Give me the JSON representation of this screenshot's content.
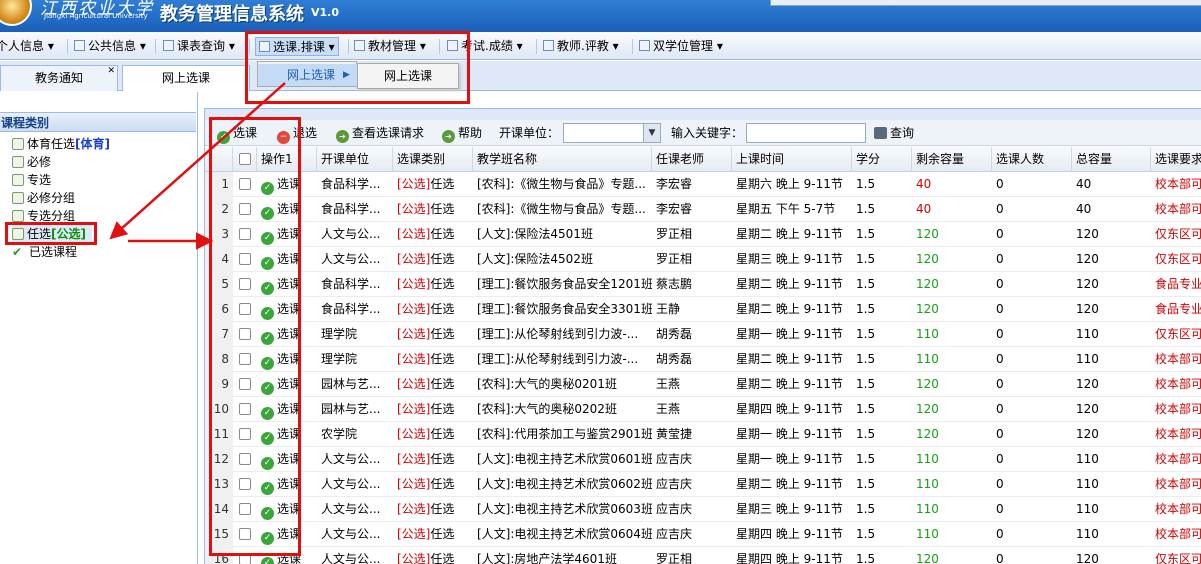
{
  "header": {
    "school_name_cn": "江西农业大学",
    "school_name_en": "Jiangxi Agricultural University",
    "system_title": "教务管理信息系统",
    "version": "V1.0"
  },
  "menubar": {
    "items": [
      {
        "label": "个人信息"
      },
      {
        "label": "公共信息"
      },
      {
        "label": "课表查询"
      },
      {
        "label": "选课.排课"
      },
      {
        "label": "教材管理"
      },
      {
        "label": "考试.成绩"
      },
      {
        "label": "教师.评教"
      },
      {
        "label": "双学位管理"
      }
    ],
    "dropdown_item": "网上选课",
    "submenu_item": "网上选课"
  },
  "tabs": [
    {
      "label": "教务通知"
    },
    {
      "label": "网上选课"
    }
  ],
  "left_panel": {
    "title": "课程类别",
    "items": [
      {
        "label": "体育任选",
        "suffix": "[体育]"
      },
      {
        "label": "必修"
      },
      {
        "label": "专选"
      },
      {
        "label": "必修分组"
      },
      {
        "label": "专选分组"
      },
      {
        "label": "任选",
        "suffix": "[公选]"
      },
      {
        "label": "已选课程"
      }
    ]
  },
  "toolbar": {
    "select_label": "选课",
    "drop_label": "退选",
    "view_requests_label": "查看选课请求",
    "help_label": "帮助",
    "unit_label": "开课单位：",
    "unit_value": "",
    "keyword_label": "输入关键字：",
    "keyword_value": "",
    "query_label": "查询"
  },
  "grid": {
    "columns": [
      "",
      "",
      "操作1",
      "开课单位",
      "选课类别",
      "教学班名称",
      "任课老师",
      "上课时间",
      "学分",
      "剩余容量",
      "选课人数",
      "总容量",
      "选课要求"
    ],
    "action_label": "选课",
    "category_prefix": "[公选]",
    "category_suffix": "任选",
    "rows": [
      {
        "no": "1",
        "unit": "食品科学...",
        "name": "[农科]:《微生物与食品》专题...",
        "teacher": "李宏睿",
        "time": "星期六 晚上 9-11节",
        "credit": "1.5",
        "remaining": "40",
        "remaining_color": "red",
        "enrolled": "0",
        "total": "40",
        "req": "校本部可"
      },
      {
        "no": "2",
        "unit": "食品科学...",
        "name": "[农科]:《微生物与食品》专题...",
        "teacher": "李宏睿",
        "time": "星期五 下午 5-7节",
        "credit": "1.5",
        "remaining": "40",
        "remaining_color": "red",
        "enrolled": "0",
        "total": "40",
        "req": "校本部可"
      },
      {
        "no": "3",
        "unit": "人文与公...",
        "name": "[人文]:保险法4501班",
        "teacher": "罗正相",
        "time": "星期二 晚上 9-11节",
        "credit": "1.5",
        "remaining": "120",
        "remaining_color": "green",
        "enrolled": "0",
        "total": "120",
        "req": "仅东区可"
      },
      {
        "no": "4",
        "unit": "人文与公...",
        "name": "[人文]:保险法4502班",
        "teacher": "罗正相",
        "time": "星期三 晚上 9-11节",
        "credit": "1.5",
        "remaining": "120",
        "remaining_color": "green",
        "enrolled": "0",
        "total": "120",
        "req": "仅东区可"
      },
      {
        "no": "5",
        "unit": "食品科学...",
        "name": "[理工]:餐饮服务食品安全1201班",
        "teacher": "蔡志鹏",
        "time": "星期二 晚上 9-11节",
        "credit": "1.5",
        "remaining": "120",
        "remaining_color": "green",
        "enrolled": "0",
        "total": "120",
        "req": "食品专业"
      },
      {
        "no": "6",
        "unit": "食品科学...",
        "name": "[理工]:餐饮服务食品安全3301班",
        "teacher": "王静",
        "time": "星期二 晚上 9-11节",
        "credit": "1.5",
        "remaining": "120",
        "remaining_color": "green",
        "enrolled": "0",
        "total": "120",
        "req": "食品专业"
      },
      {
        "no": "7",
        "unit": "理学院",
        "name": "[理工]:从伦琴射线到引力波-...",
        "teacher": "胡秀磊",
        "time": "星期一 晚上 9-11节",
        "credit": "1.5",
        "remaining": "110",
        "remaining_color": "green",
        "enrolled": "0",
        "total": "110",
        "req": "仅东区可"
      },
      {
        "no": "8",
        "unit": "理学院",
        "name": "[理工]:从伦琴射线到引力波-...",
        "teacher": "胡秀磊",
        "time": "星期二 晚上 9-11节",
        "credit": "1.5",
        "remaining": "110",
        "remaining_color": "green",
        "enrolled": "0",
        "total": "110",
        "req": "校本部可"
      },
      {
        "no": "9",
        "unit": "园林与艺...",
        "name": "[农科]:大气的奥秘0201班",
        "teacher": "王燕",
        "time": "星期二 晚上 9-11节",
        "credit": "1.5",
        "remaining": "120",
        "remaining_color": "green",
        "enrolled": "0",
        "total": "120",
        "req": "校本部可"
      },
      {
        "no": "10",
        "unit": "园林与艺...",
        "name": "[农科]:大气的奥秘0202班",
        "teacher": "王燕",
        "time": "星期四 晚上 9-11节",
        "credit": "1.5",
        "remaining": "120",
        "remaining_color": "green",
        "enrolled": "0",
        "total": "120",
        "req": "校本部可"
      },
      {
        "no": "11",
        "unit": "农学院",
        "name": "[农科]:代用茶加工与鉴赏2901班",
        "teacher": "黄莹捷",
        "time": "星期一 晚上 9-11节",
        "credit": "1.5",
        "remaining": "120",
        "remaining_color": "green",
        "enrolled": "0",
        "total": "120",
        "req": "校本部可"
      },
      {
        "no": "12",
        "unit": "人文与公...",
        "name": "[人文]:电视主持艺术欣赏0601班",
        "teacher": "应吉庆",
        "time": "星期一 晚上 9-11节",
        "credit": "1.5",
        "remaining": "110",
        "remaining_color": "green",
        "enrolled": "0",
        "total": "110",
        "req": "校本部可"
      },
      {
        "no": "13",
        "unit": "人文与公...",
        "name": "[人文]:电视主持艺术欣赏0602班",
        "teacher": "应吉庆",
        "time": "星期二 晚上 9-11节",
        "credit": "1.5",
        "remaining": "110",
        "remaining_color": "green",
        "enrolled": "0",
        "total": "110",
        "req": "校本部可"
      },
      {
        "no": "14",
        "unit": "人文与公...",
        "name": "[人文]:电视主持艺术欣赏0603班",
        "teacher": "应吉庆",
        "time": "星期三 晚上 9-11节",
        "credit": "1.5",
        "remaining": "110",
        "remaining_color": "green",
        "enrolled": "0",
        "total": "110",
        "req": "校本部可"
      },
      {
        "no": "15",
        "unit": "人文与公...",
        "name": "[人文]:电视主持艺术欣赏0604班",
        "teacher": "应吉庆",
        "time": "星期四 晚上 9-11节",
        "credit": "1.5",
        "remaining": "110",
        "remaining_color": "green",
        "enrolled": "0",
        "total": "110",
        "req": "校本部可"
      },
      {
        "no": "16",
        "unit": "人文与公...",
        "name": "[人文]:房地产法学4601班",
        "teacher": "罗正相",
        "time": "星期四 晚上 9-11节",
        "credit": "1.5",
        "remaining": "120",
        "remaining_color": "green",
        "enrolled": "0",
        "total": "120",
        "req": "仅东区可"
      }
    ]
  },
  "colors": {
    "annotation": "#e01010",
    "remaining_red": "#d40000",
    "remaining_green": "#16a016",
    "requirement": "#d40000"
  }
}
